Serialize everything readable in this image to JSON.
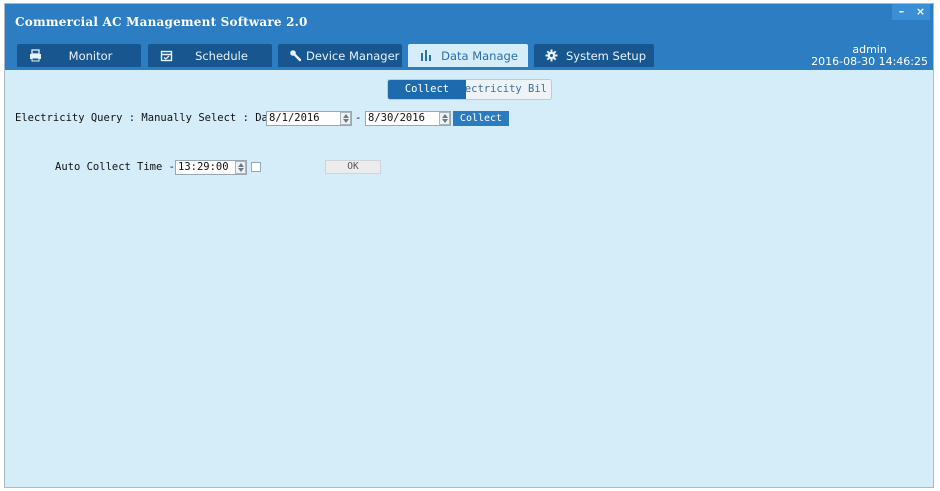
{
  "app": {
    "title": "Commercial AC Management Software 2.0"
  },
  "window_controls": {
    "minimize": "–",
    "close": "×"
  },
  "tabs": [
    {
      "label": "Monitor",
      "icon": "printer-icon",
      "active": false
    },
    {
      "label": "Schedule",
      "icon": "calendar-icon",
      "active": false
    },
    {
      "label": "Device Manager",
      "icon": "wrench-icon",
      "active": false
    },
    {
      "label": "Data Manage",
      "icon": "bar-chart-icon",
      "active": true
    },
    {
      "label": "System Setup",
      "icon": "gear-icon",
      "active": false
    }
  ],
  "user": {
    "name": "admin",
    "datetime": "2016-08-30 14:46:25"
  },
  "segment": {
    "active": "Collect",
    "inactive": "Electricity Bil"
  },
  "query": {
    "label": "Electricity  Query : Manually  Select : Date:",
    "start_date": "8/1/2016",
    "dash": "-",
    "end_date": "8/30/2016",
    "collect_button": "Collect"
  },
  "auto": {
    "label": "Auto Collect",
    "time_label": "Time -",
    "time_value": "13:29:00",
    "ok_button": "OK"
  },
  "colors": {
    "title_bar": "#2d7dc2",
    "tab_bg": "#17568f",
    "content_bg": "#d5ecf9",
    "accent": "#2a7bc0"
  }
}
